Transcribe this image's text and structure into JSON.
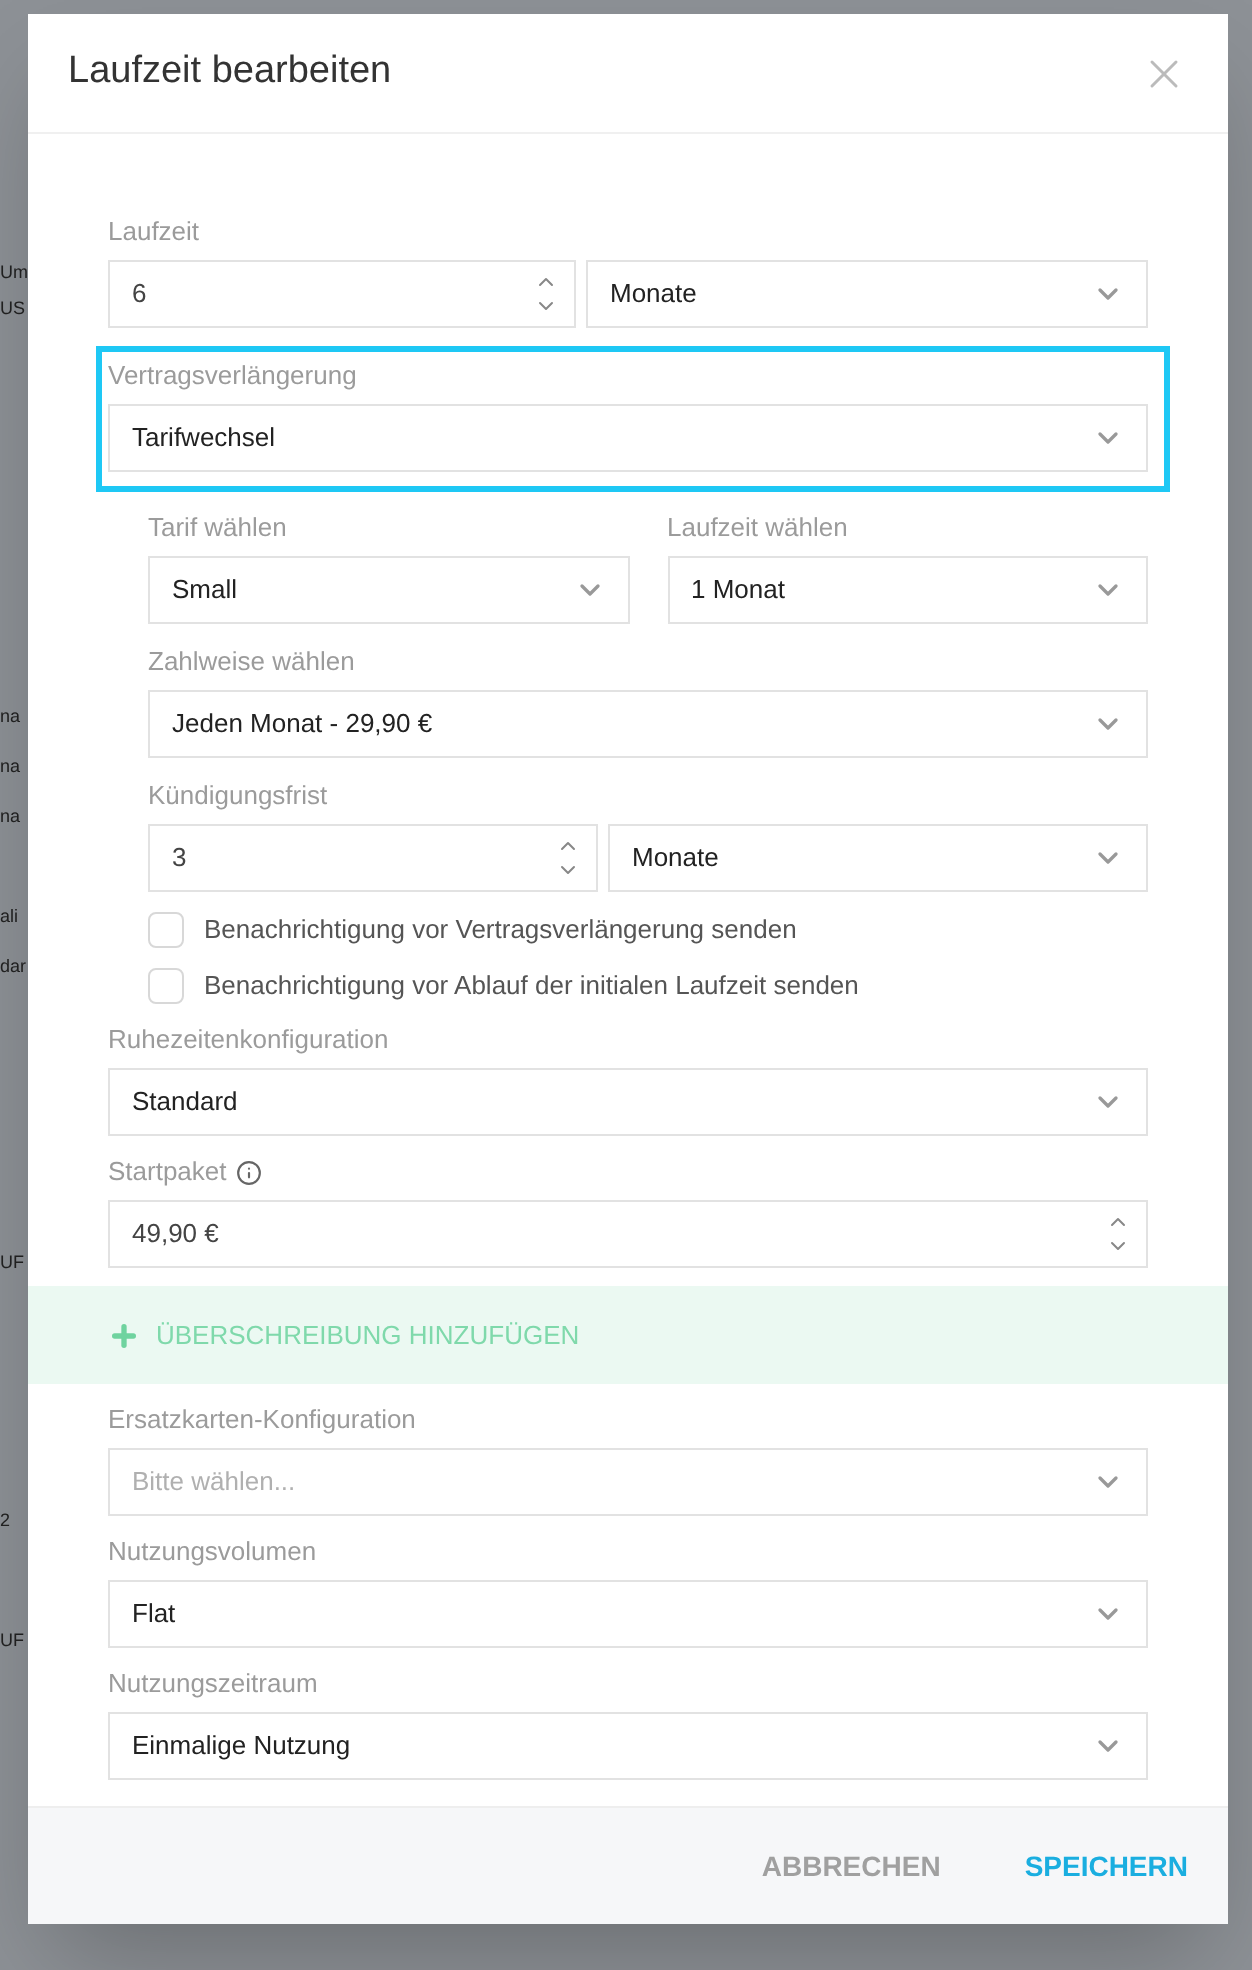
{
  "background": {
    "fragments": [
      "Um",
      "US",
      "na",
      "na",
      "na",
      "ali",
      "dar",
      "UF",
      "2",
      "UF"
    ]
  },
  "dialog": {
    "title": "Laufzeit bearbeiten"
  },
  "sections": [
    {
      "kind": "number_unit",
      "label": "Laufzeit",
      "value": "6",
      "unit": "Monate"
    },
    {
      "kind": "select",
      "label": "Vertragsverlängerung",
      "value": "Tarifwechsel",
      "highlighted": true
    },
    {
      "kind": "group",
      "children": [
        {
          "kind": "select_pair",
          "items": [
            {
              "label": "Tarif wählen",
              "value": "Small"
            },
            {
              "label": "Laufzeit wählen",
              "value": "1 Monat"
            }
          ]
        },
        {
          "kind": "select",
          "label": "Zahlweise wählen",
          "value": "Jeden Monat - 29,90 €",
          "highlighted": false
        },
        {
          "kind": "number_unit",
          "label": "Kündigungsfrist",
          "value": "3",
          "unit": "Monate"
        },
        {
          "kind": "checkbox",
          "label": "Benachrichtigung vor Vertragsverlängerung senden",
          "checked": false
        },
        {
          "kind": "checkbox",
          "label": "Benachrichtigung vor Ablauf der initialen Laufzeit senden",
          "checked": false
        }
      ]
    },
    {
      "kind": "select",
      "label": "Ruhezeitenkonfiguration",
      "value": "Standard",
      "highlighted": false
    },
    {
      "kind": "number",
      "label": "Startpaket",
      "info": true,
      "value": "49,90 €"
    },
    {
      "kind": "add_link",
      "label": "ÜBERSCHREIBUNG HINZUFÜGEN"
    },
    {
      "kind": "select",
      "label": "Ersatzkarten-Konfiguration",
      "placeholder": "Bitte wählen...",
      "highlighted": false
    },
    {
      "kind": "select",
      "label": "Nutzungsvolumen",
      "value": "Flat",
      "highlighted": false
    },
    {
      "kind": "select",
      "label": "Nutzungszeitraum",
      "value": "Einmalige Nutzung",
      "highlighted": false
    }
  ],
  "footer": {
    "buttons": [
      {
        "label": "ABBRECHEN",
        "kind": "secondary"
      },
      {
        "label": "SPEICHERN",
        "kind": "primary"
      }
    ]
  }
}
